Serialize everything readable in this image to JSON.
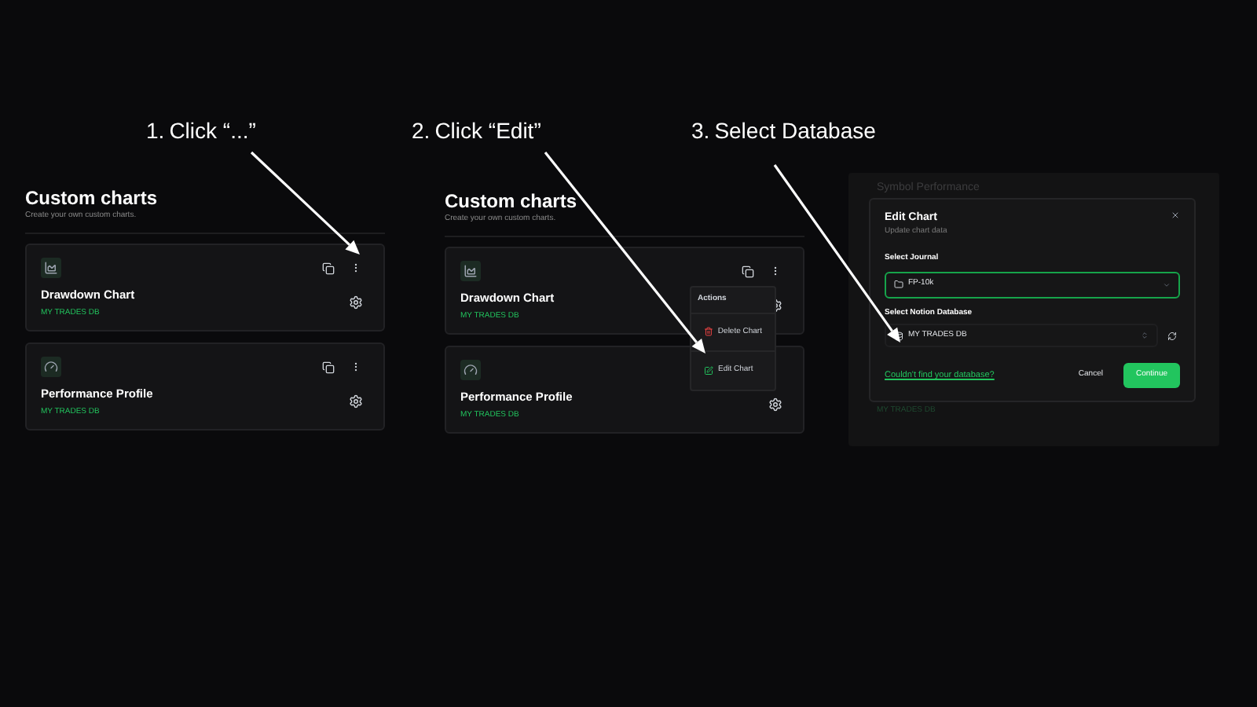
{
  "steps": [
    {
      "number": "1.",
      "text": "Click “...”"
    },
    {
      "number": "2.",
      "text": "Click “Edit”"
    },
    {
      "number": "3.",
      "text": "Select Database"
    }
  ],
  "panels": [
    {
      "kind": "list",
      "title": "Custom charts",
      "subtitle": "Create your own custom charts.",
      "cards": [
        {
          "kind": "chart",
          "title": "Drawdown Chart",
          "database": "MY TRADES DB"
        },
        {
          "kind": "gauge",
          "title": "Performance Profile",
          "database": "MY TRADES DB"
        }
      ]
    },
    {
      "kind": "list",
      "title": "Custom charts",
      "subtitle": "Create your own custom charts.",
      "cards": [
        {
          "kind": "chart",
          "title": "Drawdown Chart",
          "database": "MY TRADES DB",
          "menu": {
            "heading": "Actions",
            "items": [
              {
                "kind": "delete",
                "label": "Delete Chart"
              },
              {
                "kind": "edit",
                "label": "Edit Chart"
              }
            ]
          }
        },
        {
          "kind": "gauge",
          "title": "Performance Profile",
          "database": "MY TRADES DB"
        }
      ]
    },
    {
      "kind": "dialog",
      "background_title": "Symbol Performance",
      "background_footer": "MY TRADES DB",
      "title": "Edit Chart",
      "subtitle": "Update chart data",
      "journal_label": "Select Journal",
      "journal_value": "FP-10k",
      "journal_focused": true,
      "database_label": "Select Notion Database",
      "database_value": "MY TRADES DB",
      "link": "Couldn't find your database?",
      "cancel": "Cancel",
      "confirm": "Continue"
    }
  ]
}
